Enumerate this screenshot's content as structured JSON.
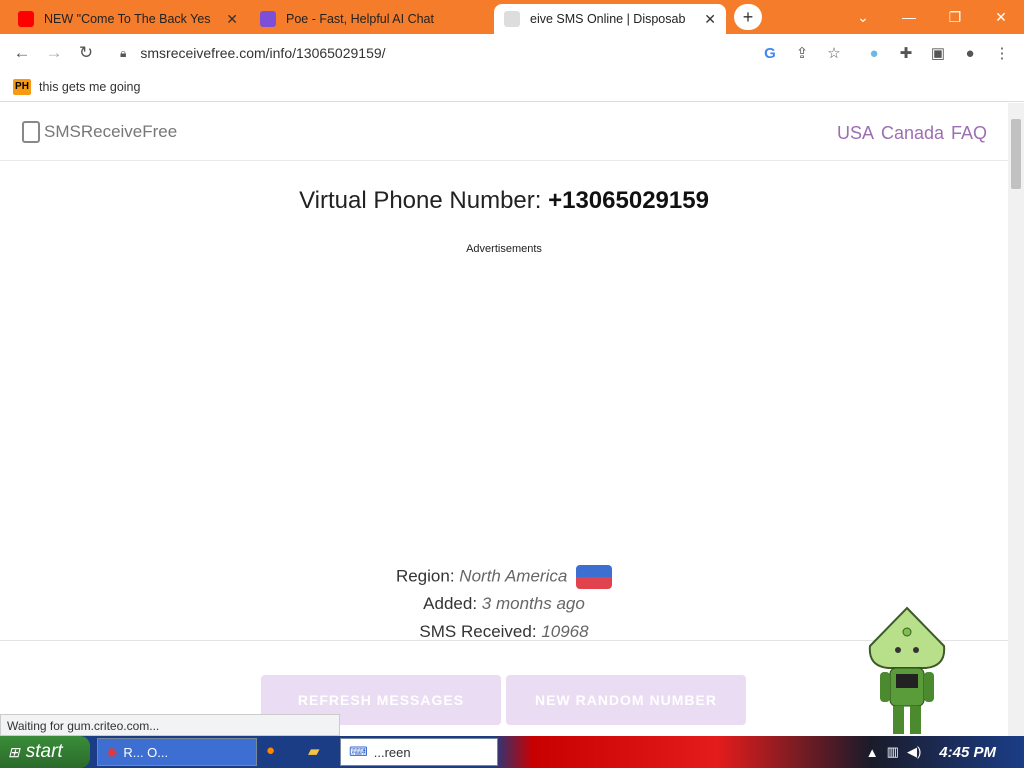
{
  "browser": {
    "tabs": [
      {
        "title": "NEW \"Come To The Back Yes",
        "active": false,
        "favicon": "youtube-icon"
      },
      {
        "title": "Poe - Fast, Helpful AI Chat",
        "active": false,
        "favicon": "poe-icon"
      },
      {
        "title": "eive SMS Online | Disposab",
        "active": true,
        "favicon": "sms-icon"
      }
    ],
    "new_tab_label": "+",
    "url": "smsreceivefree.com/info/13065029159/",
    "bookmark": "this gets me going",
    "bookmark_icon": "PH",
    "status_text": "Waiting for gum.criteo.com...",
    "accent": "#f57c2a"
  },
  "site": {
    "logo_text": "SMSReceiveFree",
    "nav": [
      "USA",
      "Canada",
      "FAQ"
    ],
    "heading_prefix": "Virtual Phone Number:",
    "phone_number": "+13065029159",
    "ads_label": "Advertisements",
    "region_label": "Region:",
    "region_value": "North America",
    "added_label": "Added:",
    "added_value": "3 months ago",
    "sms_label": "SMS Received:",
    "sms_value": "10968",
    "refresh_button": "REFRESH MESSAGES",
    "random_button": "NEW RANDOM NUMBER",
    "link_color": "#9c6fb0"
  },
  "taskbar": {
    "start_label": "start",
    "tasks": [
      "R... O...",
      "",
      "",
      "...reen"
    ],
    "clock": "4:45 PM"
  }
}
